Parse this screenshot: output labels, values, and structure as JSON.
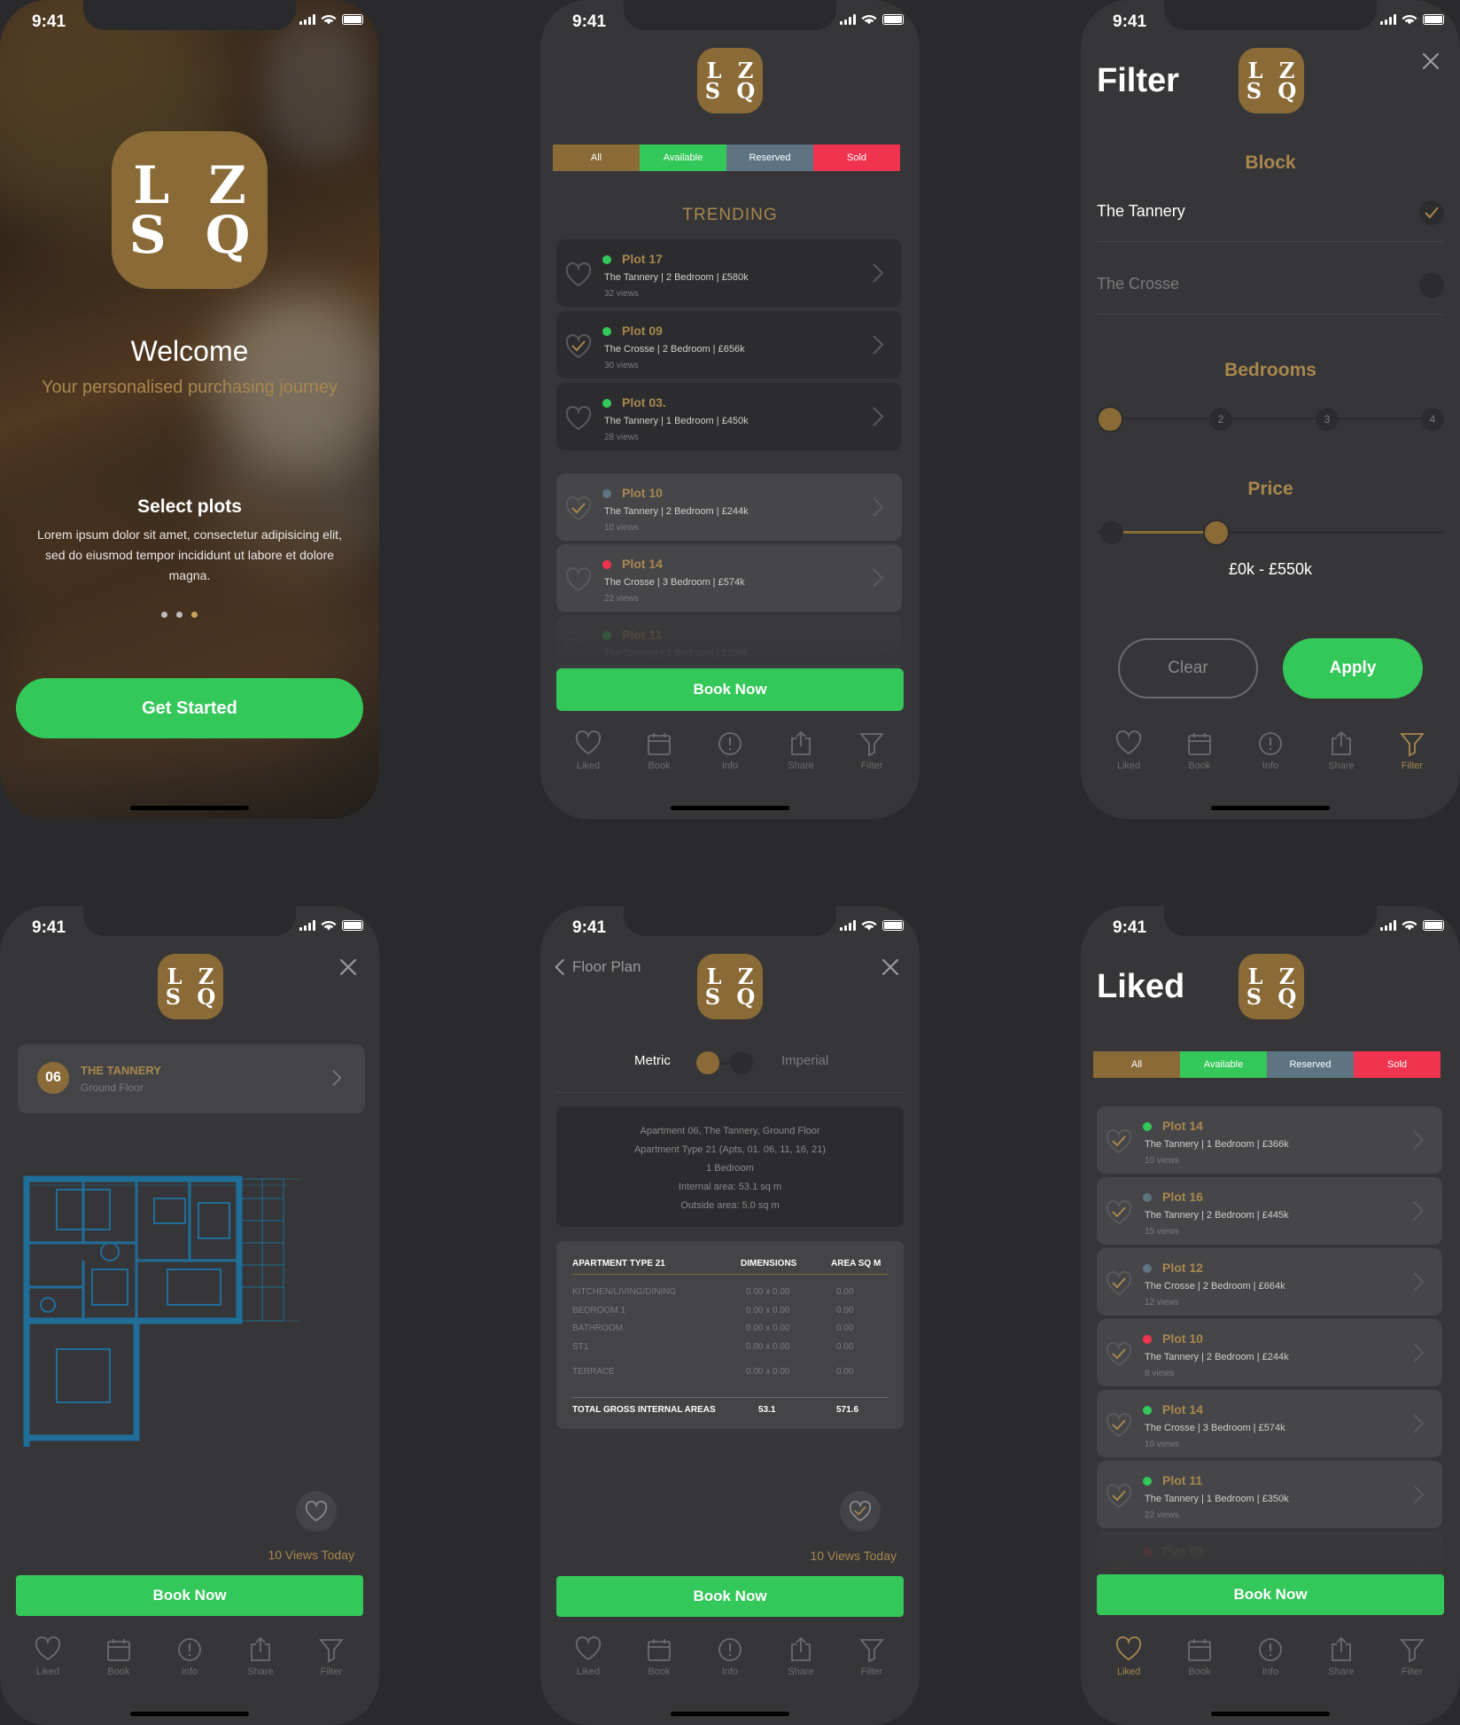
{
  "status": {
    "time": "9:41"
  },
  "logo": {
    "line1": "L Z",
    "line2": "S Q"
  },
  "welcome": {
    "title": "Welcome",
    "subtitle": "Your personalised purchasing journey",
    "section_title": "Select plots",
    "body": "Lorem ipsum dolor sit amet, consectetur adipisicing elit, sed do eiusmod tempor incididunt ut labore et dolore magna.",
    "cta": "Get Started"
  },
  "segments": [
    "All",
    "Available",
    "Reserved",
    "Sold"
  ],
  "trending": {
    "heading": "TRENDING",
    "top": [
      {
        "title": "Plot 17",
        "detail": "The Tannery  |  2 Bedroom  |  £580k",
        "views": "32 views",
        "status": "available",
        "liked": false
      },
      {
        "title": "Plot 09",
        "detail": "The Crosse  |  2 Bedroom |  £656k",
        "views": "30 views",
        "status": "available",
        "liked": true
      },
      {
        "title": "Plot 03.",
        "detail": "The Tannery  |  1 Bedroom |  £450k",
        "views": "28 views",
        "status": "available",
        "liked": false
      }
    ],
    "more": [
      {
        "title": "Plot 10",
        "detail": "The Tannery  |  2 Bedroom  |  £244k",
        "views": "10 views",
        "status": "reserved",
        "liked": true
      },
      {
        "title": "Plot 14",
        "detail": "The Crosse  |  3 Bedroom  |  £574k",
        "views": "22 views",
        "status": "sold",
        "liked": false
      },
      {
        "title": "Plot 11",
        "detail": "The Tannery  |  1 Bedroom  |  £350k",
        "views": "",
        "status": "available",
        "liked": false
      }
    ]
  },
  "book_now": "Book Now",
  "tabs": [
    "Liked",
    "Book",
    "Info",
    "Share",
    "Filter"
  ],
  "filter": {
    "title": "Filter",
    "block_heading": "Block",
    "blocks": [
      "The Tannery",
      "The Crosse"
    ],
    "bedrooms_heading": "Bedrooms",
    "bedroom_steps": [
      "1",
      "2",
      "3",
      "4"
    ],
    "price_heading": "Price",
    "price_range": "£0k - £550k",
    "clear": "Clear",
    "apply": "Apply"
  },
  "plot_detail": {
    "number": "06",
    "block": "THE TANNERY",
    "floor": "Ground Floor",
    "views_today": "10 Views Today"
  },
  "floorplan": {
    "back": "Floor Plan",
    "metric": "Metric",
    "imperial": "Imperial",
    "info": [
      "Apartment 06, The Tannery, Ground Floor",
      "Apartment Type 21 (Apts, 01. 06, 11, 16, 21)",
      "1 Bedroom",
      "Internal area: 53.1 sq m",
      "Outside area: 5.0 sq m"
    ],
    "table_headers": [
      "APARTMENT TYPE 21",
      "DIMENSIONS",
      "AREA SQ M"
    ],
    "rows": [
      [
        "KITCHEN/LIVING/DINING",
        "0.00 x 0.00",
        "0.00"
      ],
      [
        "BEDROOM 1",
        "0.00 x 0.00",
        "0.00"
      ],
      [
        "BATHROOM",
        "0.00 x 0.00",
        "0.00"
      ],
      [
        "ST1",
        "0.00 x 0.00",
        "0.00"
      ],
      [
        "TERRACE",
        "0.00 x 0.00",
        "0.00"
      ]
    ],
    "total": [
      "TOTAL GROSS INTERNAL AREAS",
      "53.1",
      "571.6"
    ],
    "views_today": "10 Views Today"
  },
  "liked": {
    "title": "Liked",
    "items": [
      {
        "title": "Plot 14",
        "detail": "The Tannery  |  1 Bedroom |  £366k",
        "views": "10 views",
        "status": "available"
      },
      {
        "title": "Plot 16",
        "detail": "The Tannery  |  2 Bedroom  |  £445k",
        "views": "15 views",
        "status": "reserved"
      },
      {
        "title": "Plot 12",
        "detail": "The Crosse  |  2 Bedroom  |  £664k",
        "views": "12 views",
        "status": "reserved"
      },
      {
        "title": "Plot 10",
        "detail": "The Tannery  |  2 Bedroom  |  £244k",
        "views": "8 views",
        "status": "sold"
      },
      {
        "title": "Plot 14",
        "detail": "The Crosse  |  3 Bedroom  |  £574k",
        "views": "10 views",
        "status": "available"
      },
      {
        "title": "Plot 11",
        "detail": "The Tannery  |  1 Bedroom  |  £350k",
        "views": "22 views",
        "status": "available"
      },
      {
        "title": "Plot 09",
        "detail": "",
        "views": "",
        "status": "sold"
      }
    ]
  },
  "colors": {
    "gold": "#8a6b37",
    "gold_text": "#a8874f",
    "green": "#34c759",
    "reserved": "#5e7483",
    "sold": "#f0344f",
    "screen": "#363638",
    "card": "#2c2c2e"
  }
}
